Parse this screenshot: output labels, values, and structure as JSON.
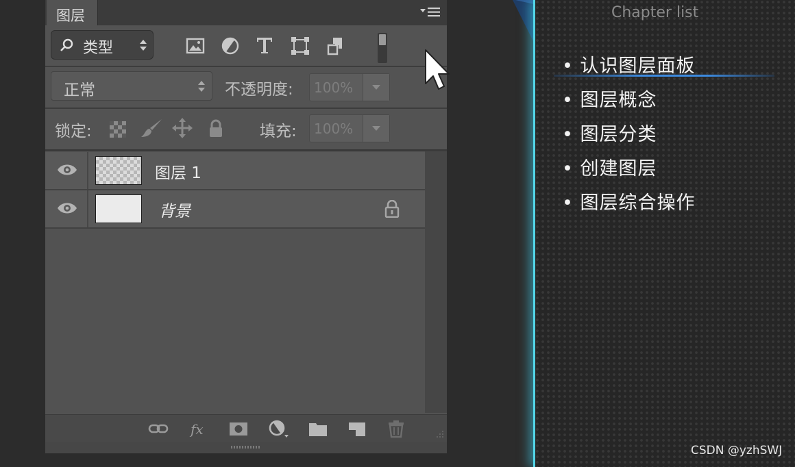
{
  "panel": {
    "tab_label": "图层",
    "filter": {
      "kind_label": "类型"
    },
    "blend": {
      "mode": "正常",
      "opacity_label": "不透明度:",
      "opacity_value": "100%"
    },
    "lock": {
      "label": "锁定:",
      "fill_label": "填充:",
      "fill_value": "100%"
    },
    "layers": [
      {
        "name": "图层 1",
        "thumbnail": "transparent",
        "visible": true
      },
      {
        "name": "背景",
        "thumbnail": "white",
        "visible": true,
        "locked": true
      }
    ],
    "bottom_icons": [
      "link-icon",
      "fx-icon",
      "mask-icon",
      "adjustment-icon",
      "folder-icon",
      "new-layer-icon",
      "trash-icon"
    ]
  },
  "chapter": {
    "title": "Chapter list",
    "items": [
      "• 认识图层面板",
      "• 图层概念",
      "• 图层分类",
      "• 创建图层",
      "• 图层综合操作"
    ]
  },
  "watermark": "CSDN @yzhSWJ",
  "colors": {
    "panel_bg": "#535353",
    "accent_glow": "#53d6e8",
    "active_underline": "#3d8be0"
  }
}
